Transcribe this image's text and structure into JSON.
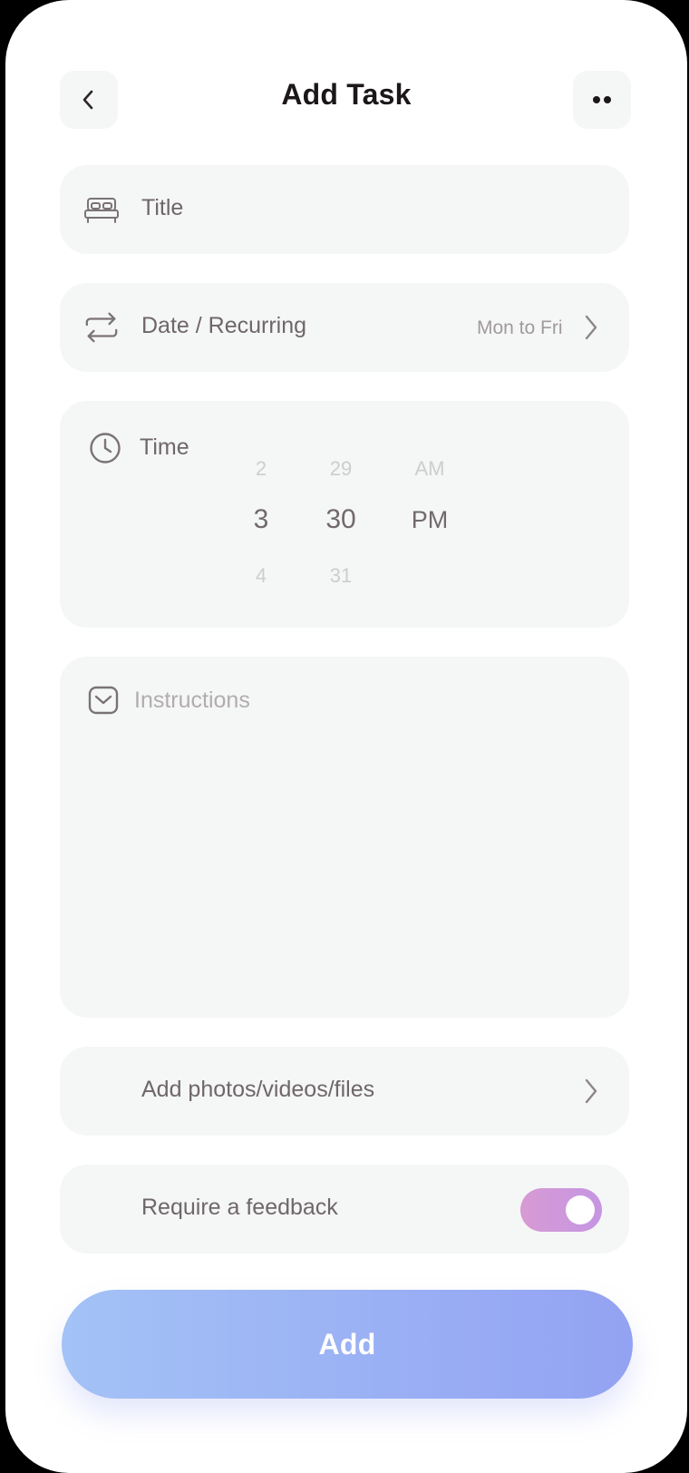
{
  "header": {
    "title": "Add Task",
    "back_icon": "chevron-left-icon",
    "more_icon": "more-dots-icon"
  },
  "title_field": {
    "placeholder": "Title",
    "icon": "bed-icon"
  },
  "date_row": {
    "label": "Date / Recurring",
    "value": "Mon to Fri",
    "icon": "repeat-icon"
  },
  "time": {
    "label": "Time",
    "icon": "clock-icon",
    "hours": {
      "prev": "2",
      "selected": "3",
      "next": "4"
    },
    "minutes": {
      "prev": "29",
      "selected": "30",
      "next": "31"
    },
    "period": {
      "prev": "AM",
      "selected": "PM"
    }
  },
  "instructions": {
    "placeholder": "Instructions",
    "icon": "message-icon"
  },
  "attachments": {
    "label": "Add photos/videos/files"
  },
  "feedback": {
    "label": "Require a feedback",
    "enabled": true
  },
  "primary_action": {
    "label": "Add"
  },
  "colors": {
    "card_bg": "#f5f6f6",
    "text_primary": "#1c1718",
    "text_secondary": "#6f6768",
    "toggle_gradient_start": "#d79ad4",
    "toggle_gradient_end": "#c596e2",
    "button_gradient_start": "#a3c2f6",
    "button_gradient_end": "#93a2f2"
  }
}
